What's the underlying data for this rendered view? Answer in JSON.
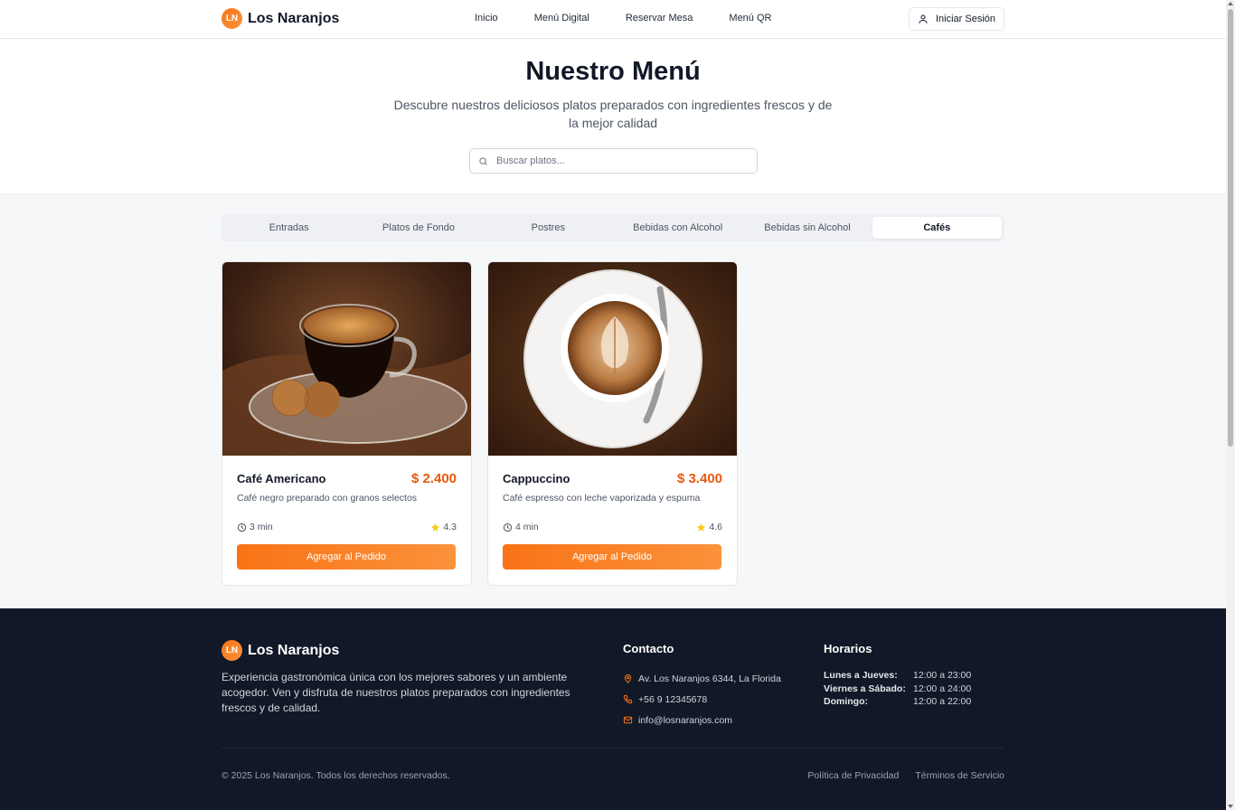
{
  "brand": {
    "logo_initials": "LN",
    "name": "Los Naranjos",
    "accent": "#f97316"
  },
  "nav": {
    "links": [
      "Inicio",
      "Menú Digital",
      "Reservar Mesa",
      "Menú QR"
    ],
    "login_label": "Iniciar Sesión"
  },
  "hero": {
    "title": "Nuestro Menú",
    "subtitle": "Descubre nuestros deliciosos platos preparados con ingredientes frescos y de la mejor calidad",
    "search_placeholder": "Buscar platos..."
  },
  "tabs": [
    {
      "label": "Entradas",
      "active": false
    },
    {
      "label": "Platos de Fondo",
      "active": false
    },
    {
      "label": "Postres",
      "active": false
    },
    {
      "label": "Bebidas con Alcohol",
      "active": false
    },
    {
      "label": "Bebidas sin Alcohol",
      "active": false
    },
    {
      "label": "Cafés",
      "active": true
    }
  ],
  "items": [
    {
      "name": "Café Americano",
      "price": "$ 2.400",
      "description": "Café negro preparado con granos selectos",
      "time": "3 min",
      "rating": "4.3",
      "button": "Agregar al Pedido",
      "image_icon": "espresso-cup-photo"
    },
    {
      "name": "Cappuccino",
      "price": "$ 3.400",
      "description": "Café espresso con leche vaporizada y espuma",
      "time": "4 min",
      "rating": "4.6",
      "button": "Agregar al Pedido",
      "image_icon": "cappuccino-latte-art-photo"
    }
  ],
  "footer": {
    "brand_name": "Los Naranjos",
    "logo_initials": "LN",
    "description": "Experiencia gastronómica única con los mejores sabores y un ambiente acogedor. Ven y disfruta de nuestros platos preparados con ingredientes frescos y de calidad.",
    "contact": {
      "heading": "Contacto",
      "address": "Av. Los Naranjos 6344, La Florida",
      "phone": "+56 9 12345678",
      "email": "info@losnaranjos.com"
    },
    "hours": {
      "heading": "Horarios",
      "rows": [
        {
          "day": "Lunes a Jueves:",
          "time": "12:00 a 23:00"
        },
        {
          "day": "Viernes a Sábado:",
          "time": "12:00 a 24:00"
        },
        {
          "day": "Domingo:",
          "time": "12:00 a 22:00"
        }
      ]
    },
    "copyright": "© 2025 Los Naranjos. Todos los derechos reservados.",
    "links": [
      "Política de Privacidad",
      "Términos de Servicio"
    ]
  }
}
